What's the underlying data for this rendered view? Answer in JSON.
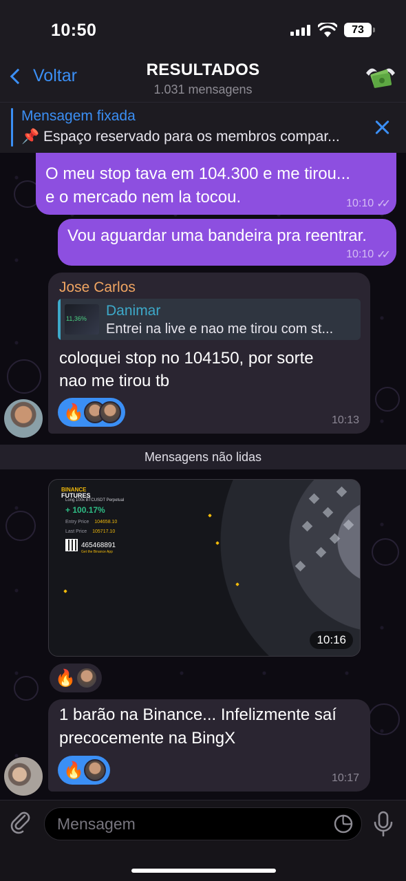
{
  "status": {
    "time": "10:50",
    "battery": "73"
  },
  "header": {
    "back_label": "Voltar",
    "title": "RESULTADOS",
    "subtitle": "1.031 mensagens"
  },
  "pinned": {
    "label": "Mensagem fixada",
    "text": "📌 Espaço reservado para os membros compar..."
  },
  "messages": [
    {
      "type": "outgoing",
      "text_line1": "O meu stop tava em 104.300 e me tirou...",
      "text_line2": "e o mercado nem la tocou.",
      "time": "10:10"
    },
    {
      "type": "outgoing",
      "text": "Vou aguardar uma bandeira pra reentrar.",
      "time": "10:10"
    },
    {
      "type": "incoming",
      "sender": "Jose Carlos",
      "reply": {
        "name": "Danimar",
        "text": "Entrei na live e nao me tirou com st...",
        "thumb_text": "11,36%"
      },
      "text_line1": "coloquei stop no 104150, por sorte",
      "text_line2": "nao me tirou tb",
      "reaction": "🔥",
      "time": "10:13"
    },
    {
      "type": "incoming-image",
      "image": {
        "brand_top": "BINANCE",
        "brand_bottom": "FUTURES",
        "pair": "Long   100x   BTCUSDT Perpetual",
        "pnl": "+ 100.17%",
        "entry_label": "Entry Price",
        "entry_value": "104658.10",
        "last_label": "Last Price",
        "last_value": "105717.10",
        "code": "465468891",
        "app_text": "Get the Binance App"
      },
      "reaction": "🔥",
      "time": "10:16"
    },
    {
      "type": "incoming",
      "text_line1": "1 barão na Binance... Infelizmente saí",
      "text_line2": "precocemente na BingX",
      "reaction": "🔥",
      "time": "10:17"
    }
  ],
  "divider": {
    "unread_label": "Mensagens não lidas"
  },
  "composer": {
    "placeholder": "Mensagem"
  },
  "colors": {
    "accent": "#3b8ff5",
    "outgoing_bubble": "#8d4fe0",
    "incoming_bubble": "#2a2531",
    "sender_name": "#f0a562",
    "reply_name": "#3da9c9"
  },
  "icons": [
    "back-chevron-icon",
    "money-wings-icon",
    "close-icon",
    "attach-icon",
    "sticker-icon",
    "mic-icon"
  ]
}
